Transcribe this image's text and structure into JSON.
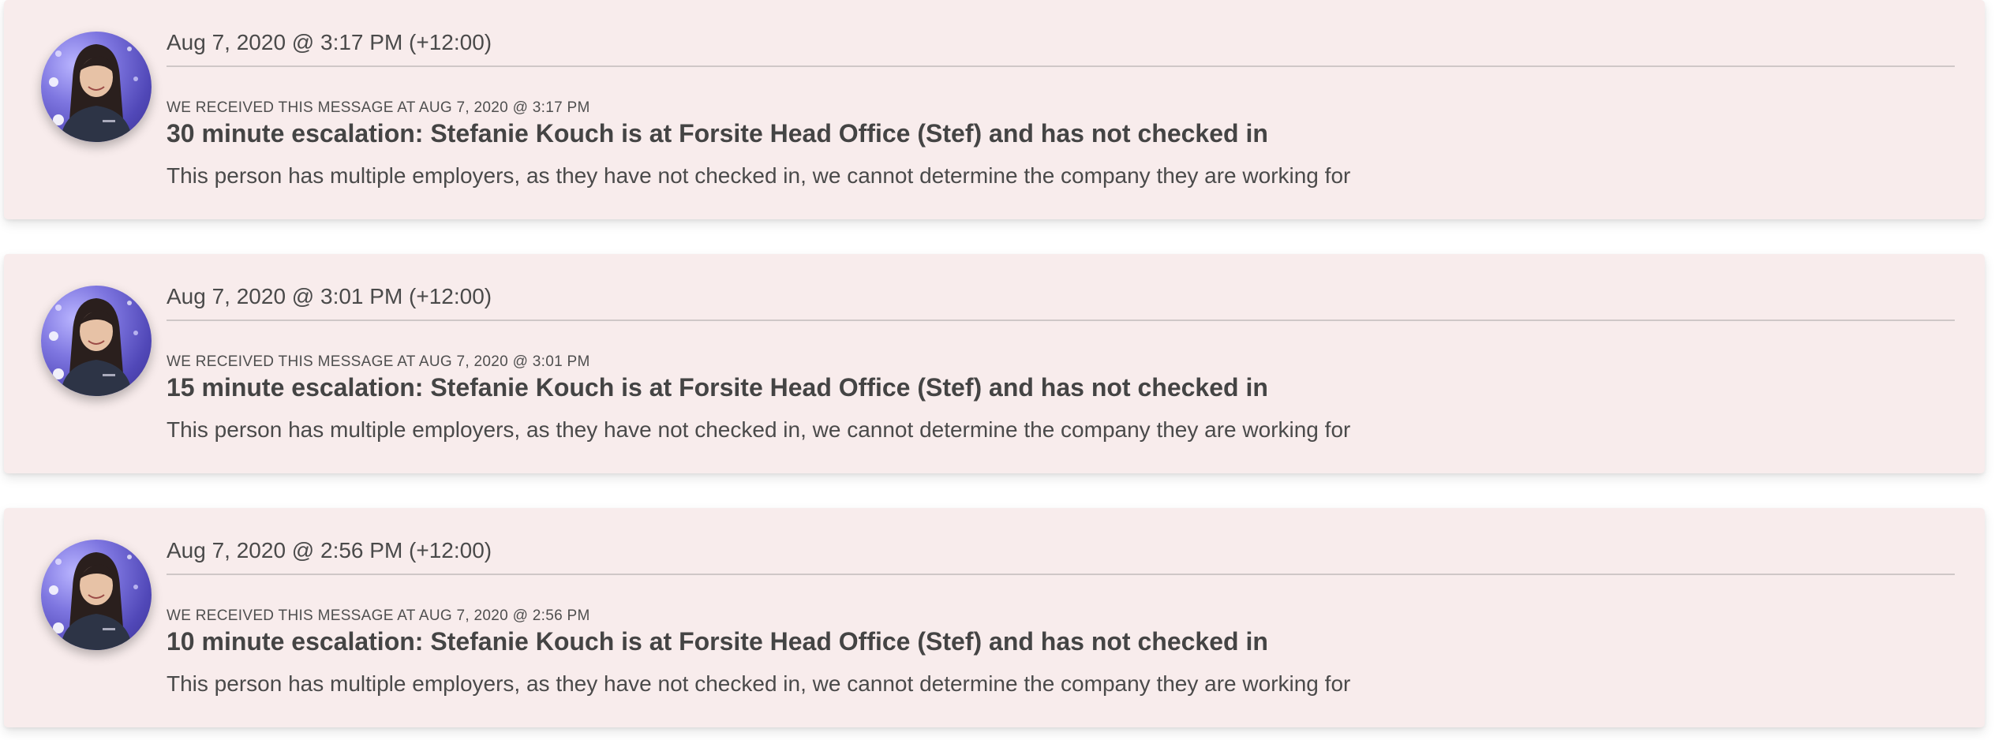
{
  "messages": [
    {
      "timestamp": "Aug 7, 2020 @ 3:17 PM (+12:00)",
      "received": "WE RECEIVED THIS MESSAGE AT AUG 7, 2020 @ 3:17 PM",
      "headline": "30 minute escalation: Stefanie Kouch is at Forsite Head Office (Stef) and has not checked in",
      "body": "This person has multiple employers, as they have not checked in, we cannot determine the company they are working for"
    },
    {
      "timestamp": "Aug 7, 2020 @ 3:01 PM (+12:00)",
      "received": "WE RECEIVED THIS MESSAGE AT AUG 7, 2020 @ 3:01 PM",
      "headline": "15 minute escalation: Stefanie Kouch is at Forsite Head Office (Stef) and has not checked in",
      "body": "This person has multiple employers, as they have not checked in, we cannot determine the company they are working for"
    },
    {
      "timestamp": "Aug 7, 2020 @ 2:56 PM (+12:00)",
      "received": "WE RECEIVED THIS MESSAGE AT AUG 7, 2020 @ 2:56 PM",
      "headline": "10 minute escalation: Stefanie Kouch is at Forsite Head Office (Stef) and has not checked in",
      "body": "This person has multiple employers, as they have not checked in, we cannot determine the company they are working for"
    }
  ],
  "colors": {
    "card_background": "#f8ecec",
    "text": "#4a4a4a",
    "divider": "#cfc7c7",
    "avatar_accent": "#7e76e0"
  },
  "icons": {
    "avatar": "user-photo-avatar"
  }
}
